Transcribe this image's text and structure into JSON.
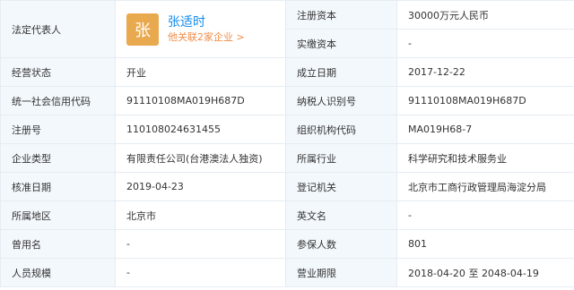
{
  "rows": [
    {
      "l1": "法定代表人",
      "l2a": "注册资本",
      "v2a": "30000万元人民币",
      "l2b": "实缴资本",
      "v2b": "-"
    },
    {
      "l1": "经营状态",
      "v1": "开业",
      "l2": "成立日期",
      "v2": "2017-12-22"
    },
    {
      "l1": "统一社会信用代码",
      "v1": "91110108MA019H687D",
      "l2": "纳税人识别号",
      "v2": "91110108MA019H687D"
    },
    {
      "l1": "注册号",
      "v1": "110108024631455",
      "l2": "组织机构代码",
      "v2": "MA019H68-7"
    },
    {
      "l1": "企业类型",
      "v1": "有限责任公司(台港澳法人独资)",
      "l2": "所属行业",
      "v2": "科学研究和技术服务业"
    },
    {
      "l1": "核准日期",
      "v1": "2019-04-23",
      "l2": "登记机关",
      "v2": "北京市工商行政管理局海淀分局"
    },
    {
      "l1": "所属地区",
      "v1": "北京市",
      "l2": "英文名",
      "v2": "-"
    },
    {
      "l1": "曾用名",
      "v1": "-",
      "l2": "参保人数",
      "v2": "801"
    },
    {
      "l1": "人员规模",
      "v1": "-",
      "l2": "营业期限",
      "v2_from": "2018-04-20",
      "v2_sep": "至",
      "v2_to": "2048-04-19"
    }
  ],
  "representative": {
    "avatar_char": "张",
    "name": "张适时",
    "link": "他关联2家企业 >"
  },
  "colors": {
    "label_bg": "#f3f8fd",
    "avatar_bg": "#e9a94f",
    "link_blue": "#128bed",
    "link_orange": "#ef8e4a"
  }
}
